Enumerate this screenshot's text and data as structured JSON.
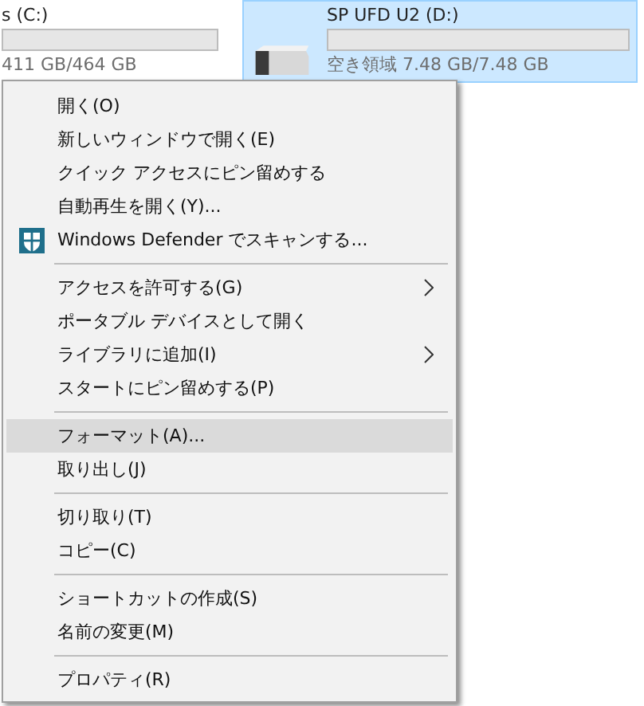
{
  "drives": [
    {
      "name": "s (C:)",
      "level": 0,
      "reading": "411 GB/464 GB",
      "selected": false
    },
    {
      "name": "SP UFD U2 (D:)",
      "level": 0,
      "reading": "空き領域 7.48 GB/7.48 GB",
      "selected": true
    }
  ],
  "context_menu": {
    "items": [
      {
        "kind": "item",
        "label": "開く(O)",
        "selected": false,
        "submenu": false
      },
      {
        "kind": "item",
        "label": "新しいウィンドウで開く(E)",
        "selected": false,
        "submenu": false
      },
      {
        "kind": "item",
        "label": "クイック アクセスにピン留めする",
        "selected": false,
        "submenu": false
      },
      {
        "kind": "item",
        "label": "自動再生を開く(Y)...",
        "selected": false,
        "submenu": false
      },
      {
        "kind": "shield_item",
        "label": "Windows Defender でスキャンする...",
        "selected": false,
        "submenu": false
      },
      {
        "kind": "separator"
      },
      {
        "kind": "item",
        "label": "アクセスを許可する(G)",
        "selected": false,
        "submenu": true
      },
      {
        "kind": "item",
        "label": "ポータブル デバイスとして開く",
        "selected": false,
        "submenu": false
      },
      {
        "kind": "item",
        "label": "ライブラリに追加(I)",
        "selected": false,
        "submenu": true
      },
      {
        "kind": "item",
        "label": "スタートにピン留めする(P)",
        "selected": false,
        "submenu": false
      },
      {
        "kind": "separator"
      },
      {
        "kind": "item",
        "label": "フォーマット(A)...",
        "selected": true,
        "submenu": false
      },
      {
        "kind": "item",
        "label": "取り出し(J)",
        "selected": false,
        "submenu": false
      },
      {
        "kind": "separator"
      },
      {
        "kind": "item",
        "label": "切り取り(T)",
        "selected": false,
        "submenu": false
      },
      {
        "kind": "item",
        "label": "コピー(C)",
        "selected": false,
        "submenu": false
      },
      {
        "kind": "separator"
      },
      {
        "kind": "item",
        "label": "ショートカットの作成(S)",
        "selected": false,
        "submenu": false
      },
      {
        "kind": "item",
        "label": "名前の変更(M)",
        "selected": false,
        "submenu": false
      },
      {
        "kind": "separator"
      },
      {
        "kind": "item",
        "label": "プロパティ(R)",
        "selected": false,
        "submenu": false
      }
    ]
  }
}
